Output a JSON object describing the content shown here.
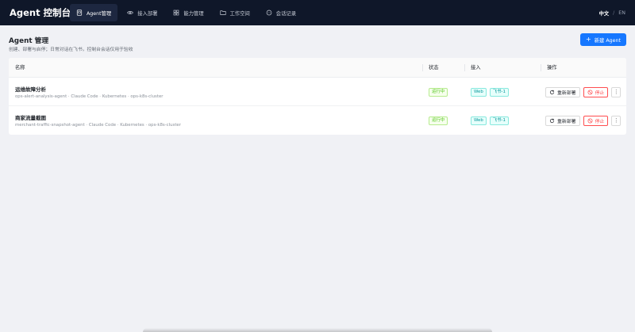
{
  "app": {
    "brand": "Agent 控制台"
  },
  "nav": [
    {
      "label": "Agent管理",
      "icon": "agent-icon",
      "active": true
    },
    {
      "label": "接入部署",
      "icon": "eye-icon",
      "active": false
    },
    {
      "label": "能力管理",
      "icon": "grid-icon",
      "active": false
    },
    {
      "label": "工作空间",
      "icon": "folder-icon",
      "active": false
    },
    {
      "label": "会话记录",
      "icon": "chat-icon",
      "active": false
    }
  ],
  "lang": {
    "current": "中文",
    "separator": "/",
    "other": "EN"
  },
  "page": {
    "title": "Agent 管理",
    "subtitle": "创建、部署与启停；日常对话在飞书，控制台会话仅用于验收",
    "new_button": "新建 Agent"
  },
  "table": {
    "columns": {
      "name": "名称",
      "status": "状态",
      "access": "接入",
      "actions": "操作"
    },
    "rows": [
      {
        "name": "运维故障分析",
        "meta": "ops-alert-analysis-agent · Claude Code · Kubernetes · ops-k8s-cluster",
        "status": "运行中",
        "channels": [
          "Web",
          "飞书-1"
        ],
        "redeploy": "重新部署",
        "stop": "停止",
        "more": "⋮"
      },
      {
        "name": "商家流量截图",
        "meta": "merchant-traffic-snapshot-agent · Claude Code · Kubernetes · ops-k8s-cluster",
        "status": "运行中",
        "channels": [
          "Web",
          "飞书-1"
        ],
        "redeploy": "重新部署",
        "stop": "停止",
        "more": "⋮"
      }
    ]
  },
  "colors": {
    "topbar": "#0f1729",
    "primary": "#1677ff",
    "running": "#52c41a",
    "danger": "#ff4d4f",
    "channel": "#08979c"
  }
}
